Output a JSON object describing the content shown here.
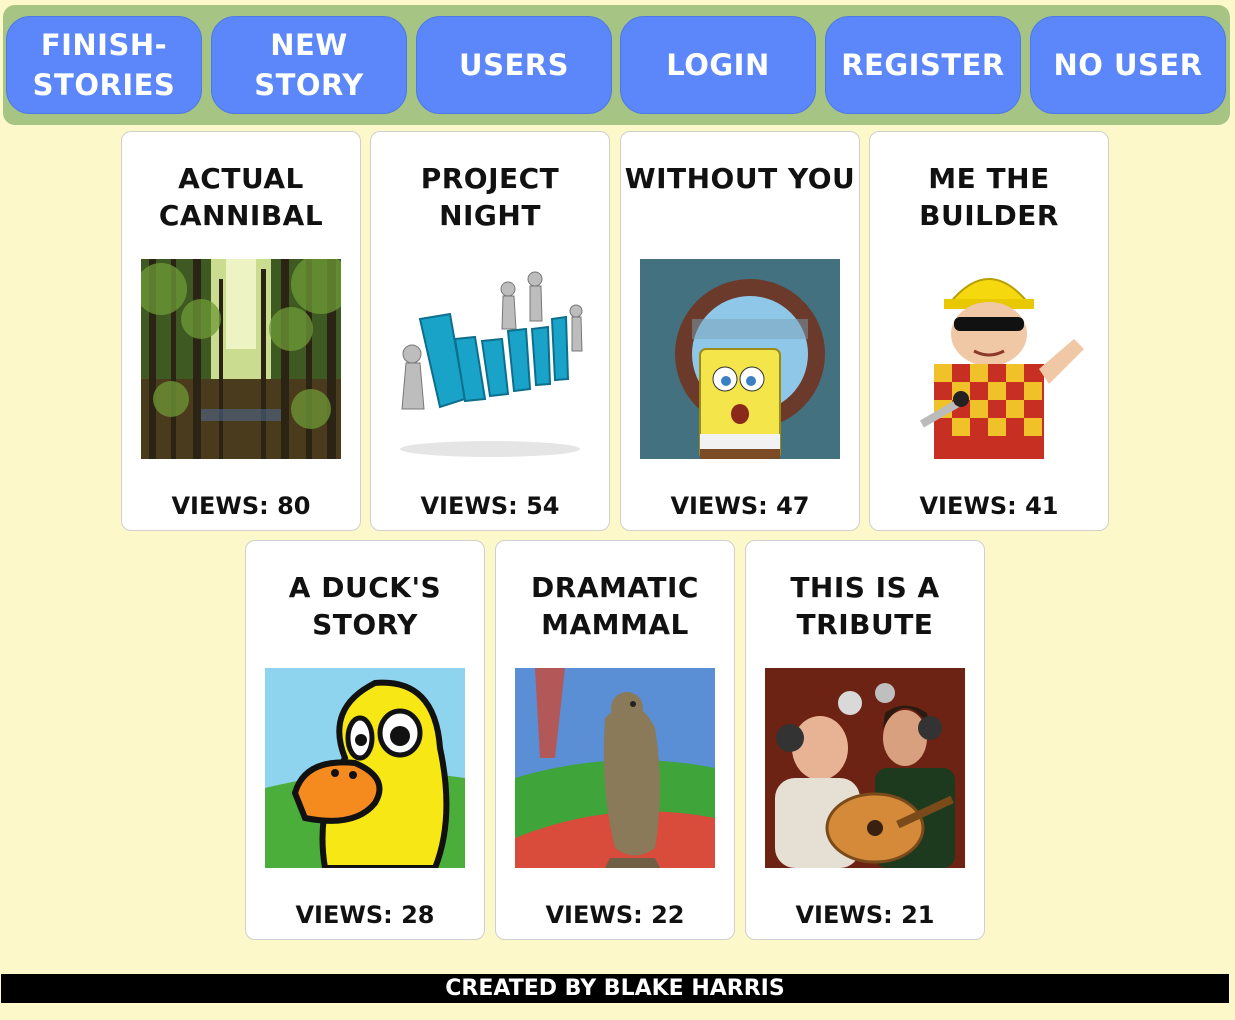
{
  "nav": {
    "finish_stories": "FINISH-\nSTORIES",
    "new_story": "NEW\nSTORY",
    "users": "USERS",
    "login": "LOGIN",
    "register": "REGISTER",
    "no_user": "NO USER"
  },
  "stories": [
    {
      "title": "ACTUAL CANNIBAL",
      "views": "VIEWS: 80",
      "image": "forest-image"
    },
    {
      "title": "PROJECT NIGHT",
      "views": "VIEWS: 54",
      "image": "project-image"
    },
    {
      "title": "WITHOUT YOU",
      "views": "VIEWS: 47",
      "image": "spongebob-image"
    },
    {
      "title": "ME THE BUILDER",
      "views": "VIEWS: 41",
      "image": "builder-image"
    },
    {
      "title": "A DUCK'S STORY",
      "views": "VIEWS: 28",
      "image": "duck-image"
    },
    {
      "title": "DRAMATIC MAMMAL",
      "views": "VIEWS: 22",
      "image": "prairie-dog-image"
    },
    {
      "title": "THIS IS A TRIBUTE",
      "views": "VIEWS: 21",
      "image": "tenacious-d-image"
    }
  ],
  "footer": {
    "text": "CREATED BY BLAKE HARRIS"
  },
  "colors": {
    "background": "#fdf8c9",
    "navbar": "#a6c483",
    "nav_button": "#5c87fa",
    "card": "#ffffff",
    "footer": "#000000"
  }
}
